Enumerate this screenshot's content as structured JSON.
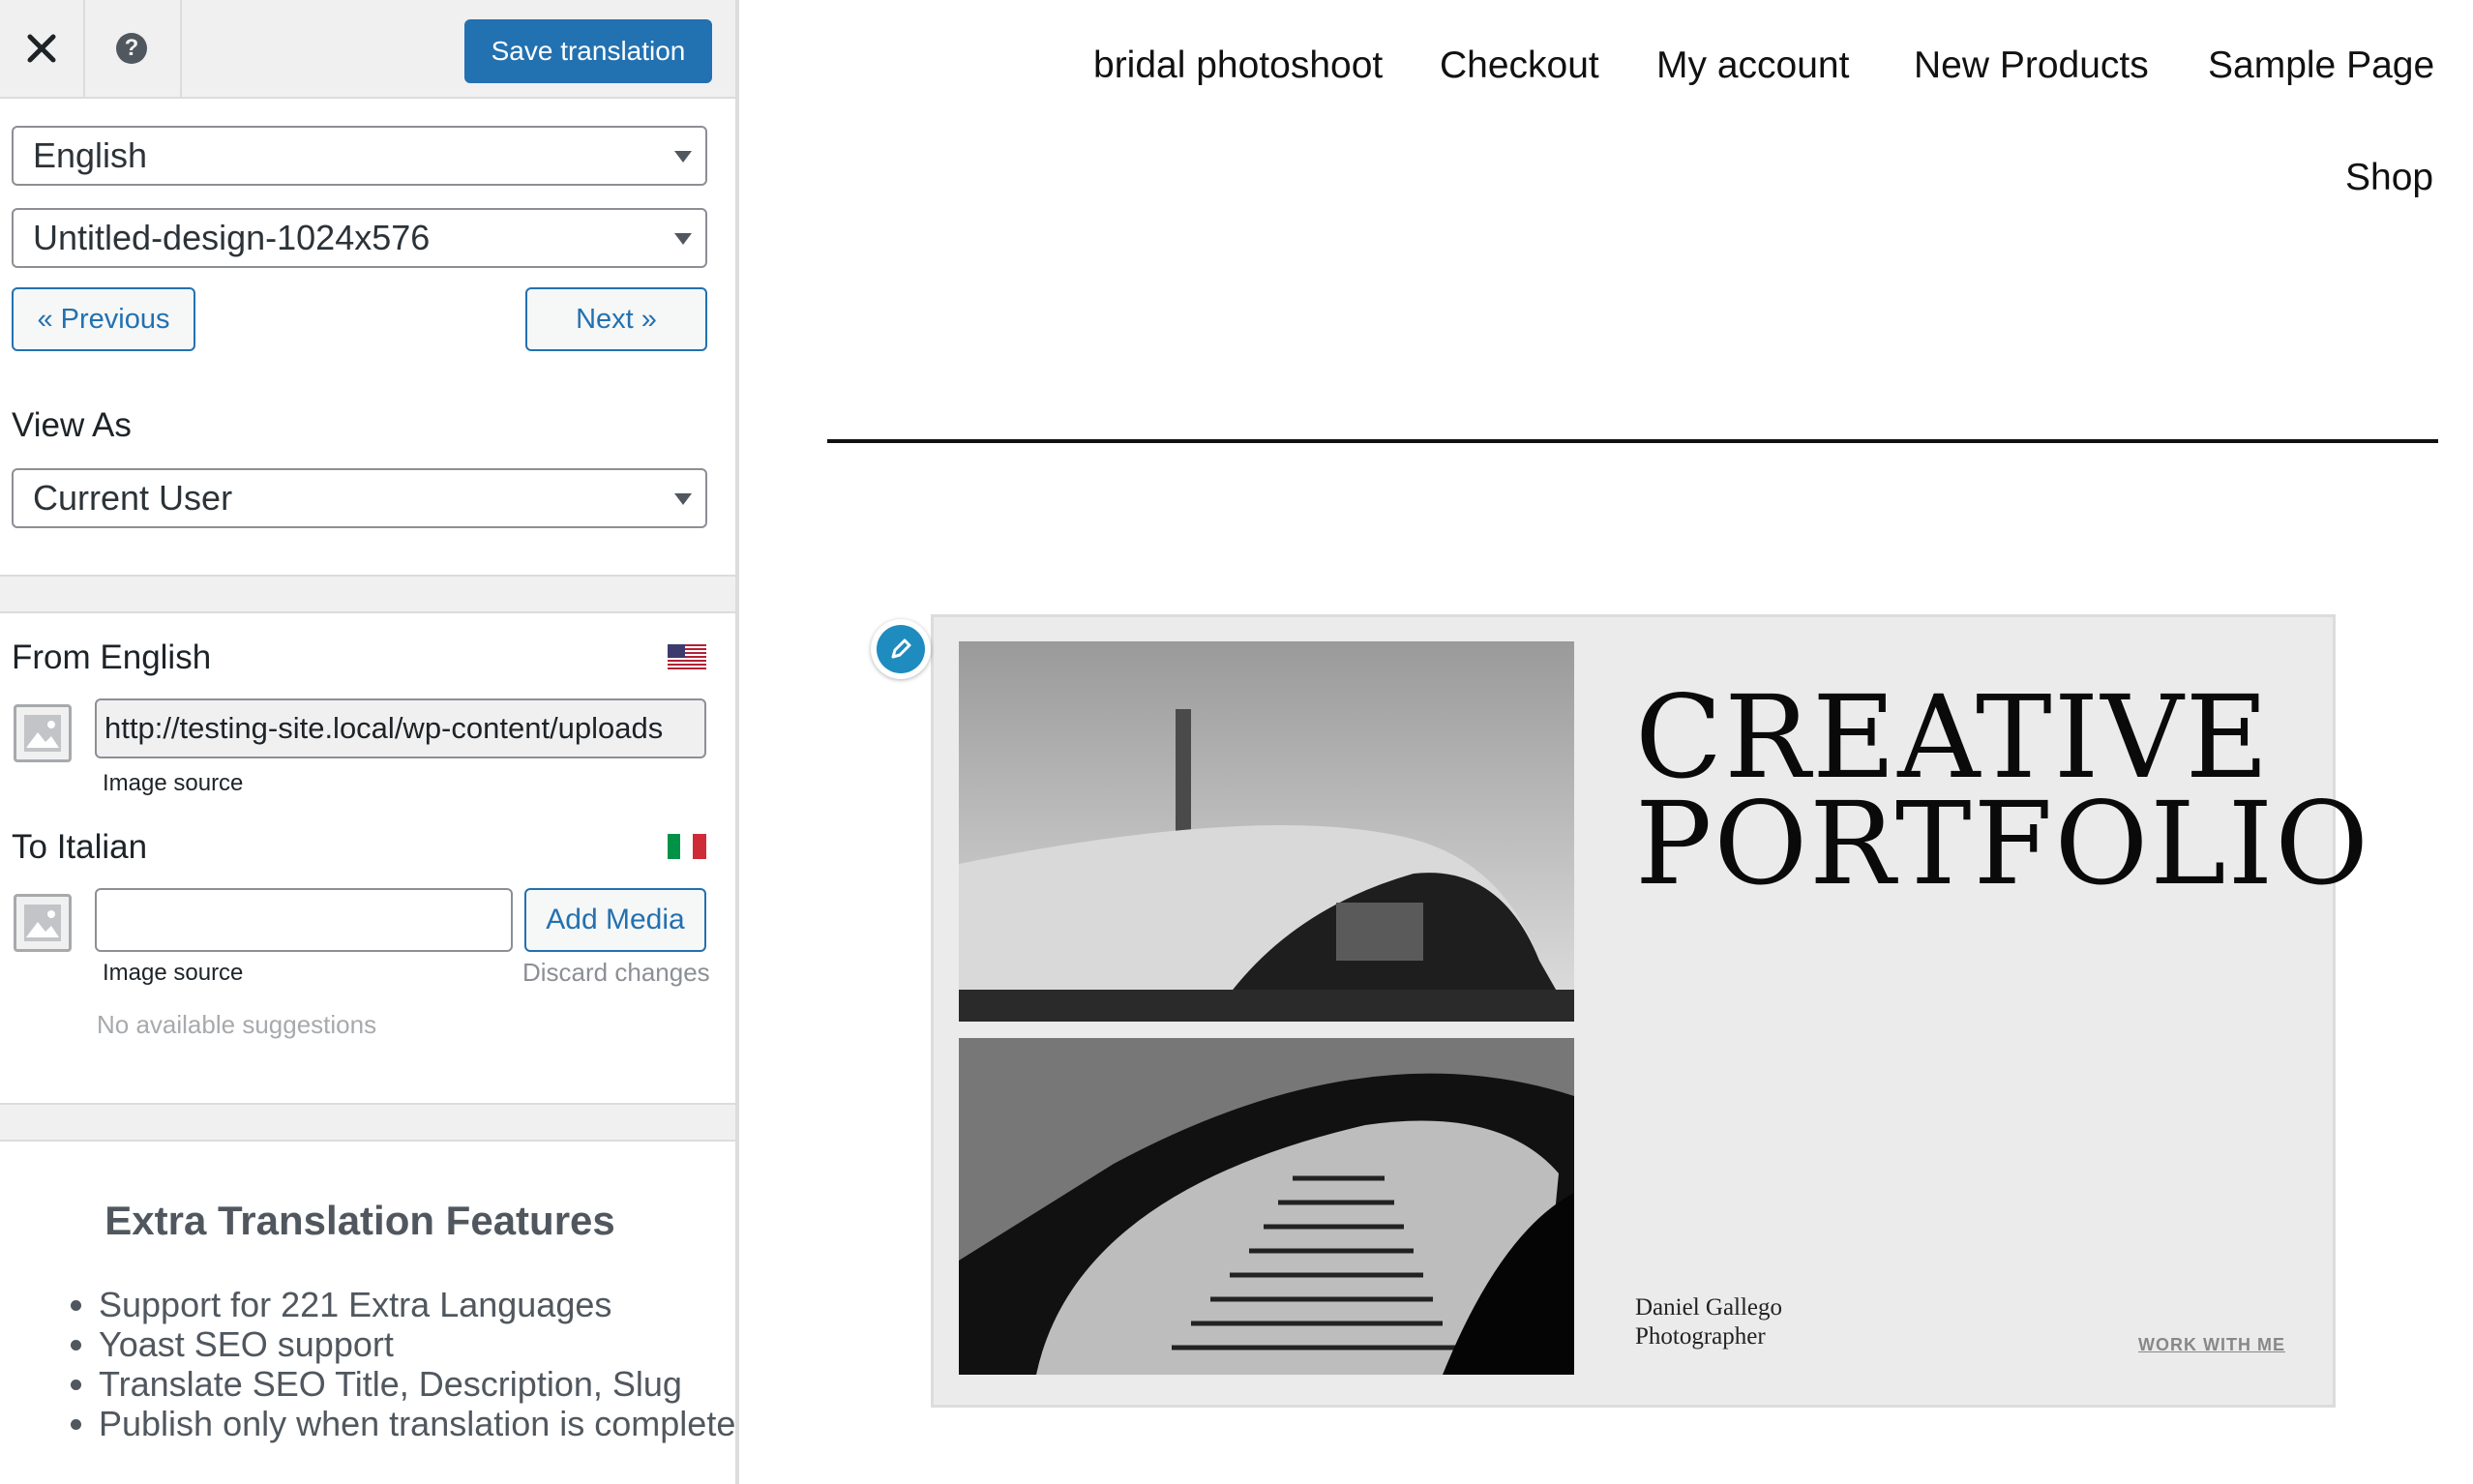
{
  "toolbar": {
    "close_icon": "close-icon",
    "help_label": "?",
    "save_label": "Save translation"
  },
  "language_select": {
    "selected": "English"
  },
  "string_select": {
    "selected": "Untitled-design-1024x576"
  },
  "navigation": {
    "previous": "« Previous",
    "next": "Next »"
  },
  "view_as": {
    "label": "View As",
    "selected": "Current User"
  },
  "source": {
    "label": "From English",
    "flag": "us-flag",
    "value": "http://testing-site.local/wp-content/uploads",
    "caption": "Image source"
  },
  "target": {
    "label": "To Italian",
    "flag": "italy-flag",
    "value": "",
    "caption": "Image source",
    "add_media": "Add Media",
    "discard": "Discard changes",
    "suggestions": "No available suggestions"
  },
  "features": {
    "title": "Extra Translation Features",
    "items": [
      "Support for 221 Extra Languages",
      "Yoast SEO support",
      "Translate SEO Title, Description, Slug",
      "Publish only when translation is complete"
    ]
  },
  "site_menu": {
    "items": [
      "bridal photoshoot",
      "Checkout",
      "My account",
      "New Products",
      "Sample Page",
      "Shop"
    ]
  },
  "hero": {
    "title_line1": "CREATIVE",
    "title_line2": "PORTFOLIO",
    "name": "Daniel Gallego",
    "role": "Photographer",
    "link": "WORK WITH ME"
  },
  "colors": {
    "accent": "#2271b1",
    "edit_badge": "#1e8cbe"
  }
}
